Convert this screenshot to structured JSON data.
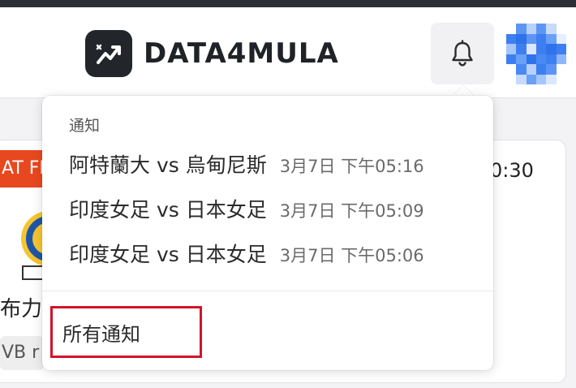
{
  "header": {
    "brand": "DATA4MULA",
    "logo_icon": "trend-chart-icon",
    "bell_icon": "bell-icon",
    "avatar": "pixelated-avatar"
  },
  "background": {
    "live_tag": "AT FE",
    "time_fragment": "0:30",
    "team_fragment": "布力",
    "vb_fragment": "VB r"
  },
  "notifications": {
    "title": "通知",
    "items": [
      {
        "match": "阿特蘭大 vs 烏甸尼斯",
        "time": "3月7日 下午05:16"
      },
      {
        "match": "印度女足 vs 日本女足",
        "time": "3月7日 下午05:09"
      },
      {
        "match": "印度女足 vs 日本女足",
        "time": "3月7日 下午05:06"
      }
    ],
    "all_link": "所有通知"
  },
  "colors": {
    "header_bg": "#ffffff",
    "logo_bg": "#22262b",
    "live_tag_bg": "#e8481f",
    "highlight_border": "#d0142c",
    "avatar_blue": "#3d7ff0"
  }
}
